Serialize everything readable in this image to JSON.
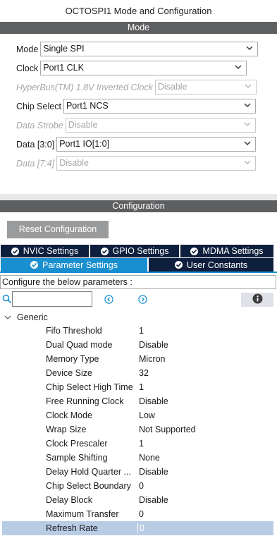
{
  "window": {
    "title": "OCTOSPI1 Mode and Configuration"
  },
  "mode_section": {
    "header": "Mode",
    "fields": [
      {
        "label": "Mode",
        "value": "Single SPI",
        "disabled": false
      },
      {
        "label": "Clock",
        "value": "Port1 CLK",
        "disabled": false
      },
      {
        "label": "HyperBus(TM) 1.8V Inverted Clock",
        "value": "Disable",
        "disabled": true
      },
      {
        "label": "Chip Select",
        "value": "Port1 NCS",
        "disabled": false
      },
      {
        "label": "Data Strobe",
        "value": "Disable",
        "disabled": true
      },
      {
        "label": "Data [3:0]",
        "value": "Port1 IO[1:0]",
        "disabled": false
      },
      {
        "label": "Data [7:4]",
        "value": "Disable",
        "disabled": true
      }
    ]
  },
  "config_section": {
    "header": "Configuration",
    "reset_label": "Reset Configuration",
    "tabs": [
      {
        "label": "NVIC Settings",
        "active": false
      },
      {
        "label": "GPIO Settings",
        "active": false
      },
      {
        "label": "MDMA Settings",
        "active": false
      },
      {
        "label": "Parameter Settings",
        "active": true
      },
      {
        "label": "User Constants",
        "active": false
      }
    ],
    "configure_text": "Configure the below parameters :",
    "search": {
      "value": "",
      "placeholder": ""
    },
    "group_label": "Generic",
    "parameters": [
      {
        "name": "Fifo Threshold",
        "value": "1"
      },
      {
        "name": "Dual Quad mode",
        "value": "Disable"
      },
      {
        "name": "Memory Type",
        "value": "Micron"
      },
      {
        "name": "Device Size",
        "value": "32"
      },
      {
        "name": "Chip Select High Time",
        "value": "1"
      },
      {
        "name": "Free Running Clock",
        "value": "Disable"
      },
      {
        "name": "Clock Mode",
        "value": "Low"
      },
      {
        "name": "Wrap Size",
        "value": "Not Supported"
      },
      {
        "name": "Clock Prescaler",
        "value": "1"
      },
      {
        "name": "Sample Shifting",
        "value": "None"
      },
      {
        "name": "Delay Hold Quarter ...",
        "value": "Disable"
      },
      {
        "name": "Chip Select Boundary",
        "value": "0"
      },
      {
        "name": "Delay Block",
        "value": "Disable"
      },
      {
        "name": "Maximum Transfer",
        "value": "0"
      },
      {
        "name": "Refresh Rate",
        "value": "0"
      }
    ]
  },
  "colors": {
    "section_bar": "#5e5f61",
    "tab_dark": "#0e1f3d",
    "tab_active": "#1a8fd0",
    "selected_row": "#b8cce4"
  },
  "icons": {
    "dropdown": "chevron-down-icon",
    "tab_status": "check-circle-icon",
    "search": "search-icon",
    "prev": "chevron-left-circle-icon",
    "next": "chevron-right-circle-icon",
    "info": "info-icon",
    "group_toggle": "chevron-down-icon"
  }
}
